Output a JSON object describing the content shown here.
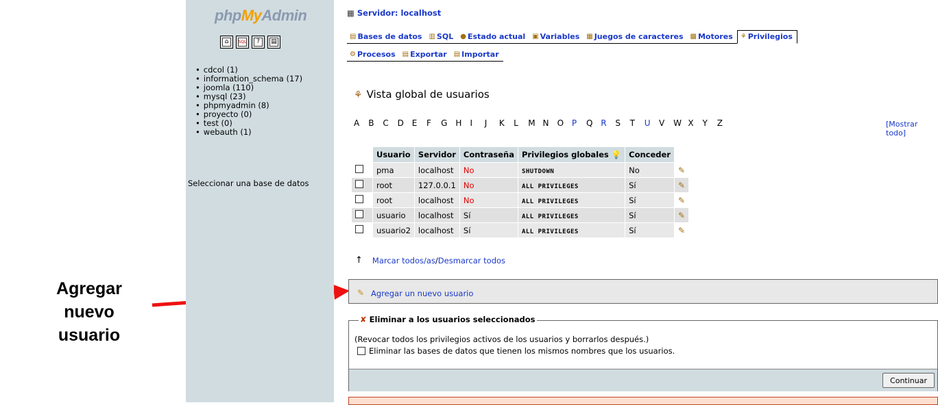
{
  "annotation": {
    "line1": "Agregar",
    "line2": "nuevo",
    "line3": "usuario",
    "arrow_color": "#ee1111"
  },
  "left": {
    "logo_php": "php",
    "logo_my": "My",
    "logo_admin": "Admin",
    "icons": [
      "home-icon",
      "sql-icon",
      "docs-icon",
      "query-icon"
    ],
    "databases": [
      "cdcol (1)",
      "information_schema (17)",
      "joomla (110)",
      "mysql (23)",
      "phpmyadmin (8)",
      "proyecto (0)",
      "test (0)",
      "webauth (1)"
    ],
    "select_db": "Seleccionar una base de datos"
  },
  "header": {
    "server": "Servidor: localhost"
  },
  "tabs_row1": [
    "Bases de datos",
    "SQL",
    "Estado actual",
    "Variables",
    "Juegos de caracteres",
    "Motores",
    "Privilegios"
  ],
  "tabs_row2": [
    "Procesos",
    "Exportar",
    "Importar"
  ],
  "active_tab": "Privilegios",
  "page_title": "Vista global de usuarios",
  "alphabet": [
    "A",
    "B",
    "C",
    "D",
    "E",
    "F",
    "G",
    "H",
    "I",
    "J",
    "K",
    "L",
    "M",
    "N",
    "O",
    "P",
    "Q",
    "R",
    "S",
    "T",
    "U",
    "V",
    "W",
    "X",
    "Y",
    "Z"
  ],
  "alphabet_links": [
    "P",
    "R",
    "U"
  ],
  "show_all_1": "[Mostrar",
  "show_all_2": "todo]",
  "table": {
    "headers": {
      "user": "Usuario",
      "host": "Servidor",
      "password": "Contraseña",
      "privileges": "Privilegios globales",
      "grant": "Conceder"
    },
    "rows": [
      {
        "user": "pma",
        "host": "localhost",
        "password": "No",
        "privileges": "SHUTDOWN",
        "grant": "No"
      },
      {
        "user": "root",
        "host": "127.0.0.1",
        "password": "No",
        "privileges": "ALL PRIVILEGES",
        "grant": "Sí"
      },
      {
        "user": "root",
        "host": "localhost",
        "password": "No",
        "privileges": "ALL PRIVILEGES",
        "grant": "Sí"
      },
      {
        "user": "usuario",
        "host": "localhost",
        "password": "Sí",
        "privileges": "ALL PRIVILEGES",
        "grant": "Sí"
      },
      {
        "user": "usuario2",
        "host": "localhost",
        "password": "Sí",
        "privileges": "ALL PRIVILEGES",
        "grant": "Sí"
      }
    ]
  },
  "mark_all": "Marcar todos/as",
  "separator": " / ",
  "unmark_all": "Desmarcar todos",
  "add_user": "Agregar un nuevo usuario",
  "delete_section": {
    "legend": "Eliminar a los usuarios seleccionados",
    "revoke_text": "(Revocar todos los privilegios activos de los usuarios y borrarlos después.)",
    "drop_db_label": "Eliminar las bases de datos que tienen los mismos nombres que los usuarios.",
    "continue_button": "Continuar"
  }
}
